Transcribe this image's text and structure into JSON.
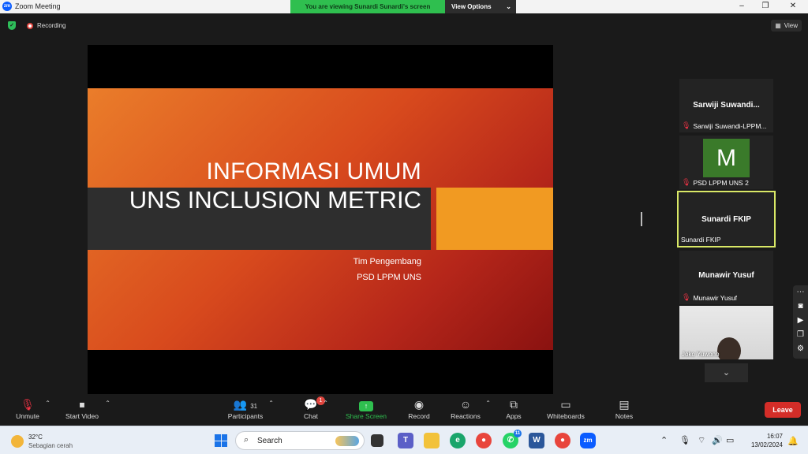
{
  "window": {
    "title": "Zoom Meeting",
    "app_icon": "zm"
  },
  "banner": {
    "message": "You are viewing Sunardi Sunardi's screen",
    "options_label": "View Options"
  },
  "topbar": {
    "recording_label": "Recording",
    "view_label": "View"
  },
  "slide": {
    "title_line1": "INFORMASI UMUM",
    "title_line2": "UNS INCLUSION METRIC",
    "subtitle_line1": "Tim Pengembang",
    "subtitle_line2": "PSD LPPM UNS"
  },
  "participants": [
    {
      "display_name": "Sarwiji  Suwandi...",
      "label": "Sarwiji Suwandi-LPPM...",
      "muted": true
    },
    {
      "avatar_letter": "M",
      "label": "PSD LPPM UNS 2",
      "muted": true
    },
    {
      "display_name": "Sunardi FKIP",
      "label": "Sunardi FKIP",
      "muted": false,
      "active_speaker": true
    },
    {
      "display_name": "Munawir Yusuf",
      "label": "Munawir Yusuf",
      "muted": true
    },
    {
      "label": "Joko Yuwono",
      "video": true
    }
  ],
  "toolbar": {
    "unmute": "Unmute",
    "start_video": "Start Video",
    "participants": "Participants",
    "participants_count": "31",
    "chat": "Chat",
    "chat_badge": "1",
    "share_screen": "Share Screen",
    "record": "Record",
    "reactions": "Reactions",
    "apps": "Apps",
    "whiteboards": "Whiteboards",
    "notes": "Notes",
    "leave": "Leave"
  },
  "taskbar": {
    "weather_temp": "32°C",
    "weather_desc": "Sebagian cerah",
    "search_placeholder": "Search",
    "whatsapp_badge": "11",
    "time": "16:07",
    "date": "13/02/2024"
  },
  "colors": {
    "share_green": "#2fbf4f",
    "leave_red": "#d42d28",
    "active_speaker_border": "#d9e866",
    "slide_orange": "#f19a22"
  }
}
